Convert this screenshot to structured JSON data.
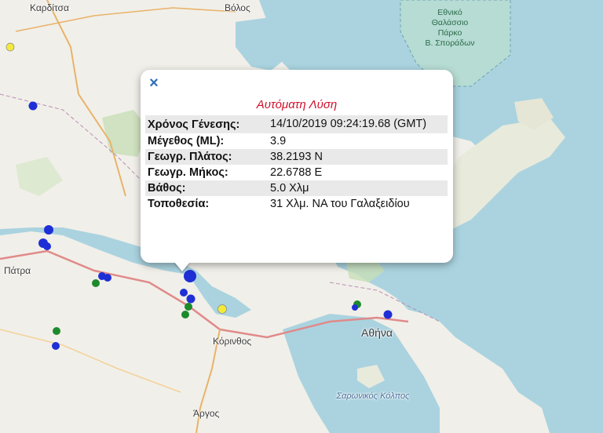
{
  "map": {
    "places": [
      {
        "id": "karditsa",
        "label": "Καρδίτσα"
      },
      {
        "id": "volos",
        "label": "Βόλος"
      },
      {
        "id": "patra",
        "label": "Πάτρα"
      },
      {
        "id": "korinthos",
        "label": "Κόρινθος"
      },
      {
        "id": "athina",
        "label": "Αθήνα"
      },
      {
        "id": "argos",
        "label": "Άργος"
      },
      {
        "id": "saronikos",
        "label": "Σαρωνικός Κόλπος"
      }
    ],
    "park_label_lines": [
      "Εθνικό",
      "Θαλάσσιο",
      "Πάρκο",
      "Β. Σποράδων"
    ],
    "colors": {
      "sea": "#aad3df",
      "land": "#f1efe9",
      "forest": "#c8dfb6",
      "quake_blue": "#1f2fd6",
      "quake_green": "#1d8a2c",
      "quake_yellow": "#f4ea3a"
    },
    "legend_note": ""
  },
  "popup": {
    "title": "Αυτόματη Λύση",
    "close_icon": "close-icon",
    "rows": [
      {
        "key": "Χρόνος Γένεσης:",
        "value": "14/10/2019 09:24:19.68 (GMT)"
      },
      {
        "key": "Μέγεθος (ML):",
        "value": "3.9"
      },
      {
        "key": "Γεωγρ. Πλάτος:",
        "value": "38.2193 N"
      },
      {
        "key": "Γεωγρ. Μήκος:",
        "value": "22.6788 E"
      },
      {
        "key": "Βάθος:",
        "value": "5.0 Χλμ"
      },
      {
        "key": "Τοποθεσία:",
        "value": "31 Χλμ. ΝΑ του Γαλαξειδίου"
      }
    ]
  }
}
